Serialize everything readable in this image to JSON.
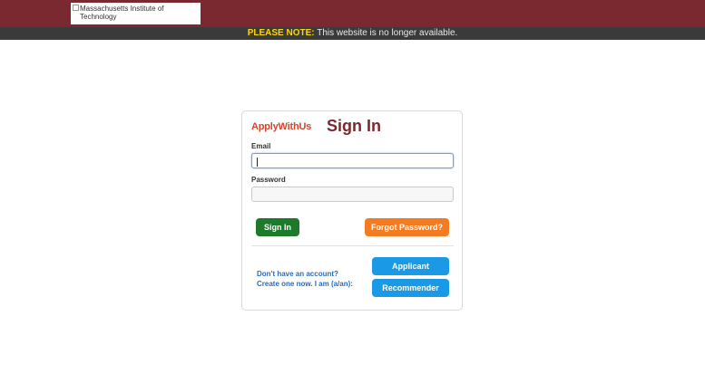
{
  "header": {
    "logo_alt": "Massachusetts Institute of Technology",
    "brand_color": "#7a2930"
  },
  "notice": {
    "highlight": "PLEASE NOTE:",
    "message": " This website is no longer available."
  },
  "login": {
    "brand": "ApplyWithUs",
    "title": "Sign In",
    "email_label": "Email",
    "email_value": "",
    "password_label": "Password",
    "password_value": "",
    "sign_in_button": "Sign In",
    "forgot_button": "Forgot Password?",
    "create_line1": "Don't have an account?",
    "create_line2": "Create one now. I am (a/an):",
    "applicant_button": "Applicant",
    "recommender_button": "Recommender"
  },
  "colors": {
    "signin_green": "#1d7a2a",
    "forgot_orange": "#f47b20",
    "role_blue": "#1a9ae6",
    "link_blue": "#2a6bbd"
  }
}
